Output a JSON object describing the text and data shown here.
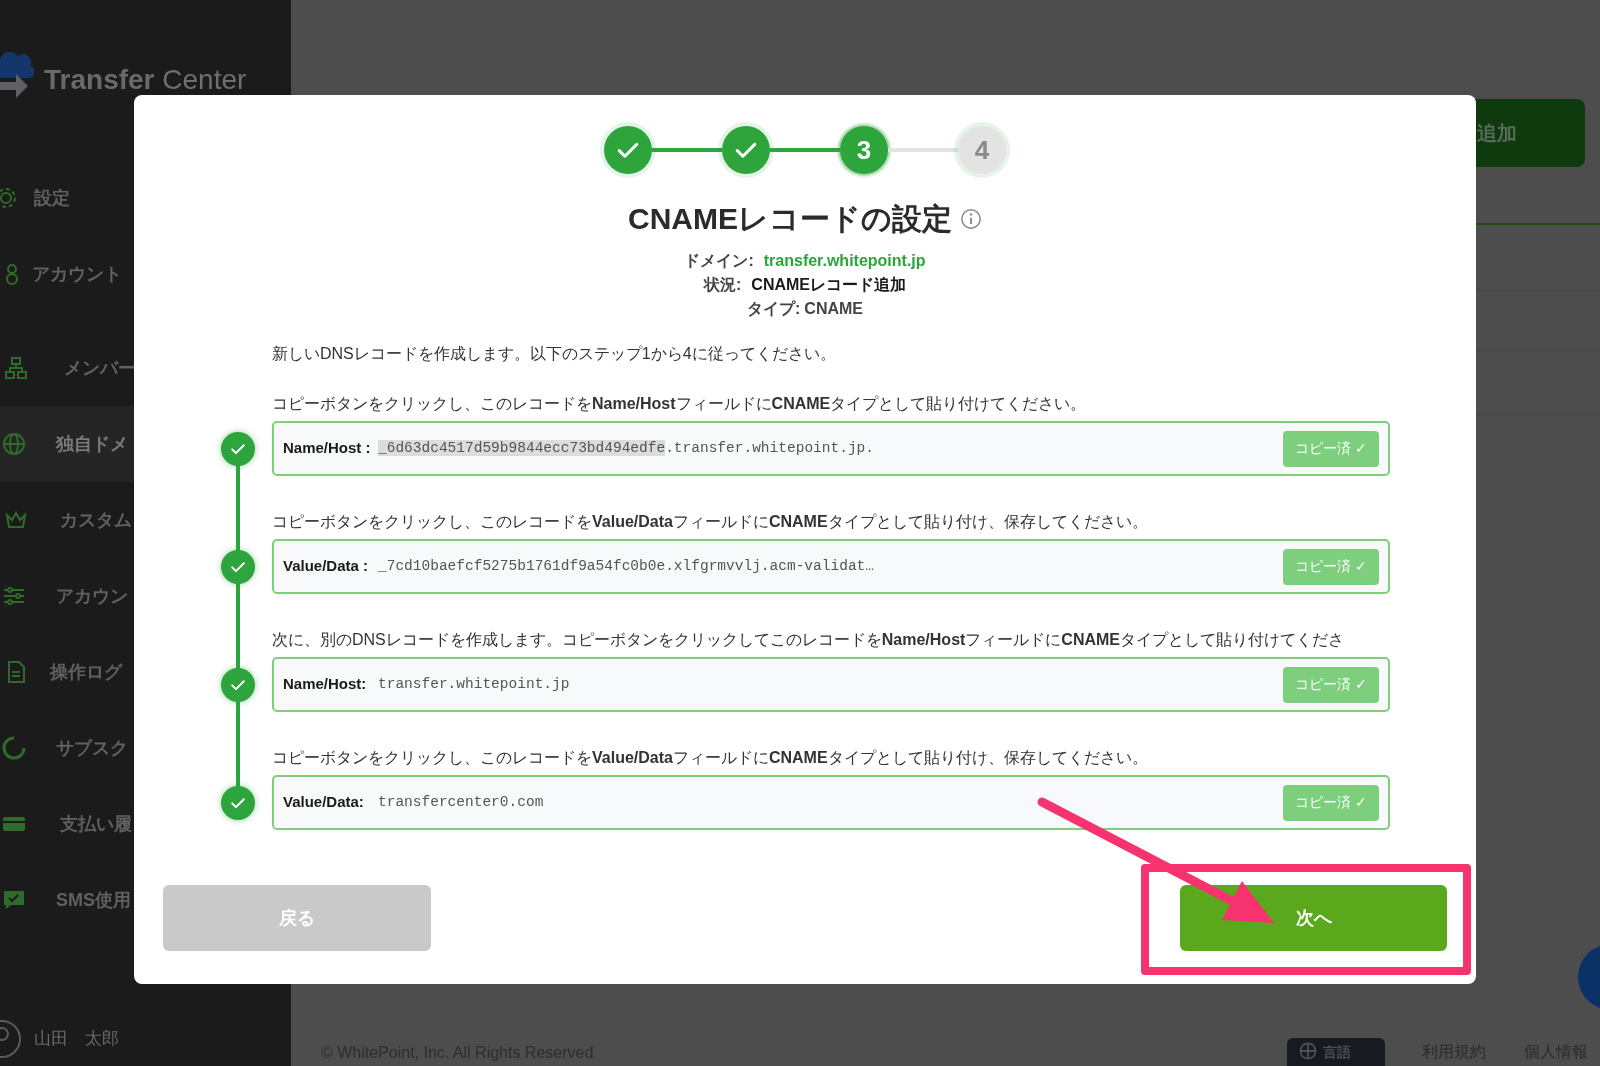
{
  "sidebar": {
    "brand": [
      "Transfer",
      "Center"
    ],
    "items": [
      {
        "label": "設定",
        "selected": false
      },
      {
        "label": "アカウント",
        "selected": false
      },
      {
        "label": "メンバー",
        "selected": false
      },
      {
        "label": "独自ドメ",
        "selected": true
      },
      {
        "label": "カスタム",
        "selected": false
      },
      {
        "label": "アカウン",
        "selected": false
      },
      {
        "label": "操作ログ",
        "selected": false
      },
      {
        "label": "サブスク",
        "selected": false
      },
      {
        "label": "支払い履",
        "selected": false
      },
      {
        "label": "SMS使用",
        "selected": false
      }
    ],
    "user": "山田　太郎"
  },
  "page": {
    "add_button": "追加"
  },
  "footer": {
    "copyright": "© WhitePoint, Inc. All Rights Reserved",
    "language": "言語",
    "links": [
      "利用規約",
      "個人情報"
    ]
  },
  "dialog": {
    "steps": [
      {
        "completed": true,
        "active": false
      },
      {
        "completed": true,
        "active": false
      },
      {
        "completed": false,
        "active": true,
        "number": "3"
      },
      {
        "completed": false,
        "active": false,
        "number": "4"
      }
    ],
    "title": "CNAMEレコードの設定",
    "info": [
      {
        "label": "ドメイン:",
        "value": "transfer.whitepoint.jp",
        "kind": "link"
      },
      {
        "label": "状況:",
        "value": "CNAMEレコード追加",
        "kind": "strong"
      },
      {
        "label": "タイプ:",
        "value": "CNAME",
        "kind": "plain"
      }
    ],
    "intro": "新しいDNSレコードを作成します。以下のステップ1から4に従ってください。",
    "records": [
      {
        "instruction": "コピーボタンをクリックし、このレコードを**Name/Host**フィールドに**CNAME**タイプとして貼り付けてください。",
        "label": "Name/Host :",
        "highlighted": "_6d63dc4517d59b9844ecc73bd494edfe",
        "value": ".transfer.whitepoint.jp.",
        "copy_button": "コピー済 ✓",
        "done": true
      },
      {
        "instruction": "コピーボタンをクリックし、このレコードを**Value/Data**フィールドに**CNAME**タイプとして貼り付け、保存してください。",
        "label": "Value/Data :",
        "value": "_7cd10baefcf5275b1761df9a54fc0b0e.xlfgrmvvlj.acm-validat…",
        "copy_button": "コピー済 ✓",
        "done": true
      },
      {
        "instruction": "次に、別のDNSレコードを作成します。コピーボタンをクリックしてこのレコードを**Name/Host**フィールドに**CNAME**タイプとして貼り付けてくださ",
        "label": "Name/Host:",
        "value": "transfer.whitepoint.jp",
        "copy_button": "コピー済 ✓",
        "done": true
      },
      {
        "instruction": "コピーボタンをクリックし、このレコードを**Value/Data**フィールドに**CNAME**タイプとして貼り付け、保存してください。",
        "label": "Value/Data:",
        "value": "transfercenter0.com",
        "copy_button": "コピー済 ✓",
        "done": true
      }
    ],
    "back_button": {
      "label": "戻る",
      "disabled": true
    },
    "next_button": {
      "label": "次へ"
    }
  }
}
